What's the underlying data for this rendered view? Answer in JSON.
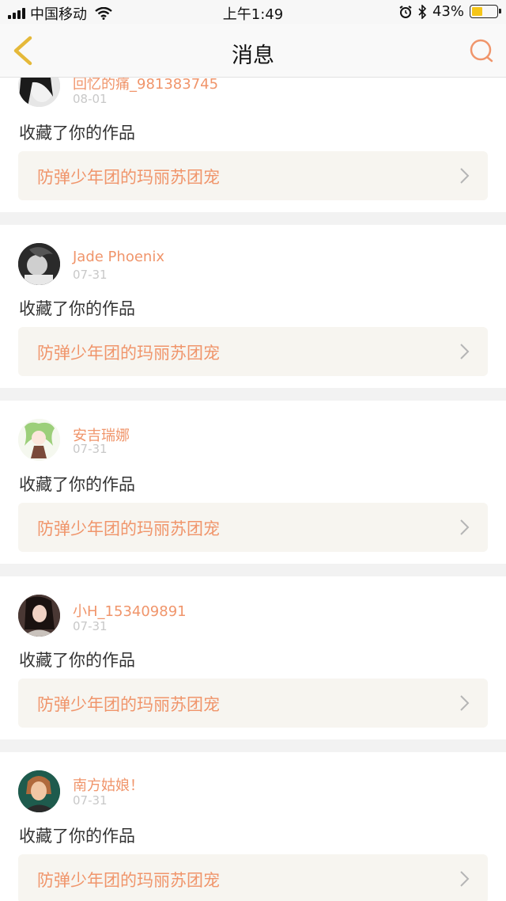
{
  "status_bar": {
    "carrier": "中国移动",
    "time": "上午1:49",
    "battery_percent": "43%",
    "battery_level": 0.43,
    "battery_color": "#f5c518"
  },
  "nav": {
    "title": "消息",
    "back_icon": "chevron-left-icon",
    "search_icon": "search-icon",
    "accent_color": "#f0956b"
  },
  "messages": [
    {
      "user": "回忆的痛_981383745",
      "date": "08-01",
      "action": "收藏了你的作品",
      "work": "防弹少年团的玛丽苏团宠"
    },
    {
      "user": "Jade Phoenix",
      "date": "07-31",
      "action": "收藏了你的作品",
      "work": "防弹少年团的玛丽苏团宠"
    },
    {
      "user": "安吉瑞娜",
      "date": "07-31",
      "action": "收藏了你的作品",
      "work": "防弹少年团的玛丽苏团宠"
    },
    {
      "user": "小H_153409891",
      "date": "07-31",
      "action": "收藏了你的作品",
      "work": "防弹少年团的玛丽苏团宠"
    },
    {
      "user": "南方姑娘！",
      "date": "07-31",
      "action": "收藏了你的作品",
      "work": "防弹少年团的玛丽苏团宠"
    }
  ]
}
